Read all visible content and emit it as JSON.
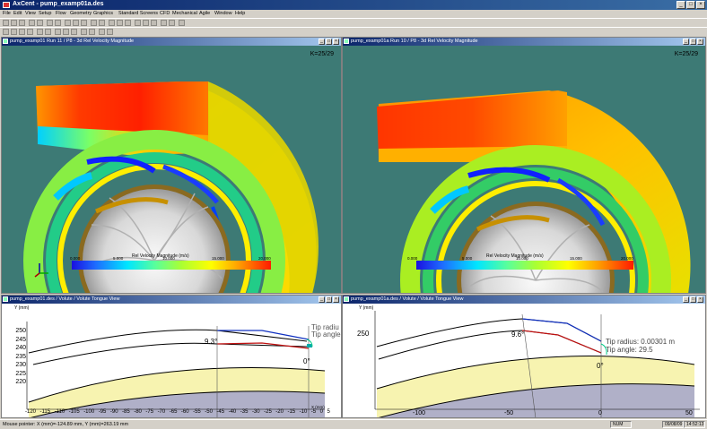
{
  "app": {
    "title": "AxCent - pump_examp01a.des"
  },
  "menu": [
    "File",
    "Edit",
    "View",
    "Setup",
    "Flow",
    "Geometry",
    "Graphics",
    "Standard Screens",
    "CFD",
    "Mechanical",
    "Agile",
    "Window",
    "Help"
  ],
  "panels": {
    "top_left": {
      "title": "pump_examp01 Run 11 / P8 - 3d Rel Velocity Magnitude",
      "k_label": "K=25/29",
      "legend_title": "Rel Velocity Magnitude (m/s)",
      "legend_ticks": [
        "0.000",
        "5.000",
        "10.000",
        "15.000",
        "20.000"
      ]
    },
    "top_right": {
      "title": "pump_examp01a Run 10 / P8 - 3d Rel Velocity Magnitude",
      "k_label": "K=25/29",
      "legend_title": "Rel Velocity Magnitude (m/s)",
      "legend_ticks": [
        "0.000",
        "5.000",
        "10.000",
        "15.000",
        "20.000"
      ]
    },
    "bottom_left": {
      "title": "pump_examp01.des / Volute / Volute Tongue View",
      "y_axis_label": "Y (mm)",
      "y_ticks": [
        "250",
        "245",
        "240",
        "235",
        "230",
        "225",
        "220"
      ],
      "x_ticks": [
        "-120",
        "-115",
        "-110",
        "-105",
        "-100",
        "-95",
        "-90",
        "-85",
        "-80",
        "-75",
        "-70",
        "-65",
        "-60",
        "-55",
        "-50",
        "-45",
        "-40",
        "-35",
        "-30",
        "-25",
        "-20",
        "-15",
        "-10",
        "-5",
        "0",
        "5"
      ],
      "x_axis_label": "X (mm)",
      "angle_label": "9.3°",
      "zero_angle": "0°",
      "tip_radius": "Tip radiu",
      "tip_angle": "Tip angle"
    },
    "bottom_right": {
      "title": "pump_examp01a.des / Volute / Volute Tongue View",
      "y_axis_label": "Y (mm)",
      "y_ticks": [
        "250"
      ],
      "x_ticks": [
        "-100",
        "-50",
        "0",
        "50"
      ],
      "angle_label": "9.6°",
      "zero_angle": "0°",
      "tip_radius": "Tip radius: 0.00301 m",
      "tip_angle": "Tip angle: 29.5"
    }
  },
  "status": {
    "pointer": "Mouse pointer: X (mm)=-124.89 mm, Y (mm)=263.19 mm",
    "num": "NUM",
    "date": "09/08/09",
    "time": "14:52:13"
  },
  "colors": {
    "title_blue": "#0a246a",
    "view_bg": "#3d7a75",
    "volute_fill": "#f7f3b0",
    "hub_fill": "#b0b0c8"
  }
}
